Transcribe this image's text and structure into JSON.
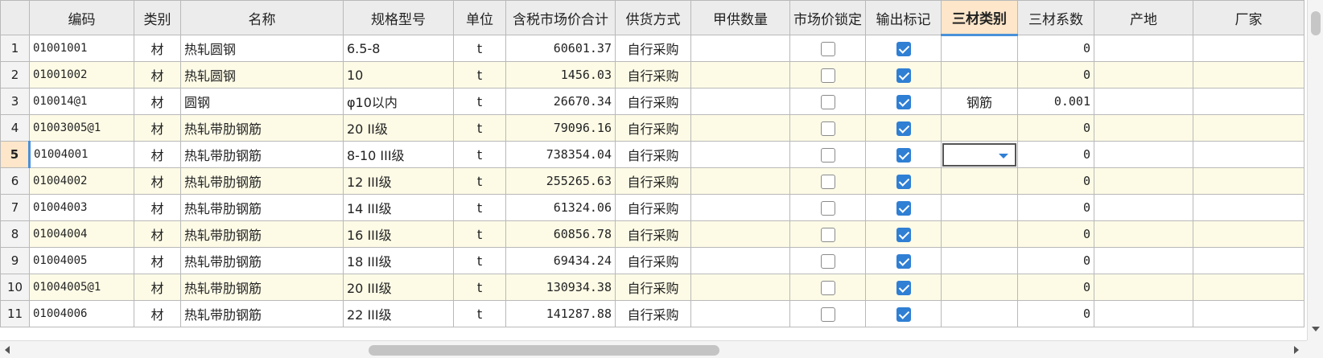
{
  "columns": [
    "",
    "编码",
    "类别",
    "名称",
    "规格型号",
    "单位",
    "含税市场价合计",
    "供货方式",
    "甲供数量",
    "市场价锁定",
    "输出标记",
    "三材类别",
    "三材系数",
    "产地",
    "厂家"
  ],
  "active_column": "三材类别",
  "current_row": "5",
  "rows": [
    {
      "num": "1",
      "code": "01001001",
      "type": "材",
      "name": "热轧圆钢",
      "spec": "6.5-8",
      "unit": "t",
      "price": "60601.37",
      "supply": "自行采购",
      "qty": "",
      "locked": false,
      "output": true,
      "mat_type": "",
      "coef": "0",
      "origin": "",
      "maker": ""
    },
    {
      "num": "2",
      "code": "01001002",
      "type": "材",
      "name": "热轧圆钢",
      "spec": "10",
      "unit": "t",
      "price": "1456.03",
      "supply": "自行采购",
      "qty": "",
      "locked": false,
      "output": true,
      "mat_type": "",
      "coef": "0",
      "origin": "",
      "maker": ""
    },
    {
      "num": "3",
      "code": "010014@1",
      "type": "材",
      "name": "圆钢",
      "spec": "φ10以内",
      "unit": "t",
      "price": "26670.34",
      "supply": "自行采购",
      "qty": "",
      "locked": false,
      "output": true,
      "mat_type": "钢筋",
      "coef": "0.001",
      "origin": "",
      "maker": ""
    },
    {
      "num": "4",
      "code": "01003005@1",
      "type": "材",
      "name": "热轧带肋钢筋",
      "spec": "20 II级",
      "unit": "t",
      "price": "79096.16",
      "supply": "自行采购",
      "qty": "",
      "locked": false,
      "output": true,
      "mat_type": "",
      "coef": "0",
      "origin": "",
      "maker": ""
    },
    {
      "num": "5",
      "code": "01004001",
      "type": "材",
      "name": "热轧带肋钢筋",
      "spec": "8-10 III级",
      "unit": "t",
      "price": "738354.04",
      "supply": "自行采购",
      "qty": "",
      "locked": false,
      "output": true,
      "mat_type": "",
      "coef": "0",
      "origin": "",
      "maker": ""
    },
    {
      "num": "6",
      "code": "01004002",
      "type": "材",
      "name": "热轧带肋钢筋",
      "spec": "12 III级",
      "unit": "t",
      "price": "255265.63",
      "supply": "自行采购",
      "qty": "",
      "locked": false,
      "output": true,
      "mat_type": "",
      "coef": "0",
      "origin": "",
      "maker": ""
    },
    {
      "num": "7",
      "code": "01004003",
      "type": "材",
      "name": "热轧带肋钢筋",
      "spec": "14 III级",
      "unit": "t",
      "price": "61324.06",
      "supply": "自行采购",
      "qty": "",
      "locked": false,
      "output": true,
      "mat_type": "",
      "coef": "0",
      "origin": "",
      "maker": ""
    },
    {
      "num": "8",
      "code": "01004004",
      "type": "材",
      "name": "热轧带肋钢筋",
      "spec": "16 III级",
      "unit": "t",
      "price": "60856.78",
      "supply": "自行采购",
      "qty": "",
      "locked": false,
      "output": true,
      "mat_type": "",
      "coef": "0",
      "origin": "",
      "maker": ""
    },
    {
      "num": "9",
      "code": "01004005",
      "type": "材",
      "name": "热轧带肋钢筋",
      "spec": "18 III级",
      "unit": "t",
      "price": "69434.24",
      "supply": "自行采购",
      "qty": "",
      "locked": false,
      "output": true,
      "mat_type": "",
      "coef": "0",
      "origin": "",
      "maker": ""
    },
    {
      "num": "10",
      "code": "01004005@1",
      "type": "材",
      "name": "热轧带肋钢筋",
      "spec": "20 III级",
      "unit": "t",
      "price": "130934.38",
      "supply": "自行采购",
      "qty": "",
      "locked": false,
      "output": true,
      "mat_type": "",
      "coef": "0",
      "origin": "",
      "maker": ""
    },
    {
      "num": "11",
      "code": "01004006",
      "type": "材",
      "name": "热轧带肋钢筋",
      "spec": "22 III级",
      "unit": "t",
      "price": "141287.88",
      "supply": "自行采购",
      "qty": "",
      "locked": false,
      "output": true,
      "mat_type": "",
      "coef": "0",
      "origin": "",
      "maker": ""
    }
  ],
  "colors": {
    "header_bg": "#ececec",
    "active_header_bg": "#fde6c9",
    "alt_row_bg": "#fdfbe6",
    "checkbox_checked": "#2f7fd4",
    "selection_accent": "#4a90d9"
  },
  "icons": {
    "dropdown": "chevron-down-icon",
    "checkbox": "checkbox-icon"
  }
}
